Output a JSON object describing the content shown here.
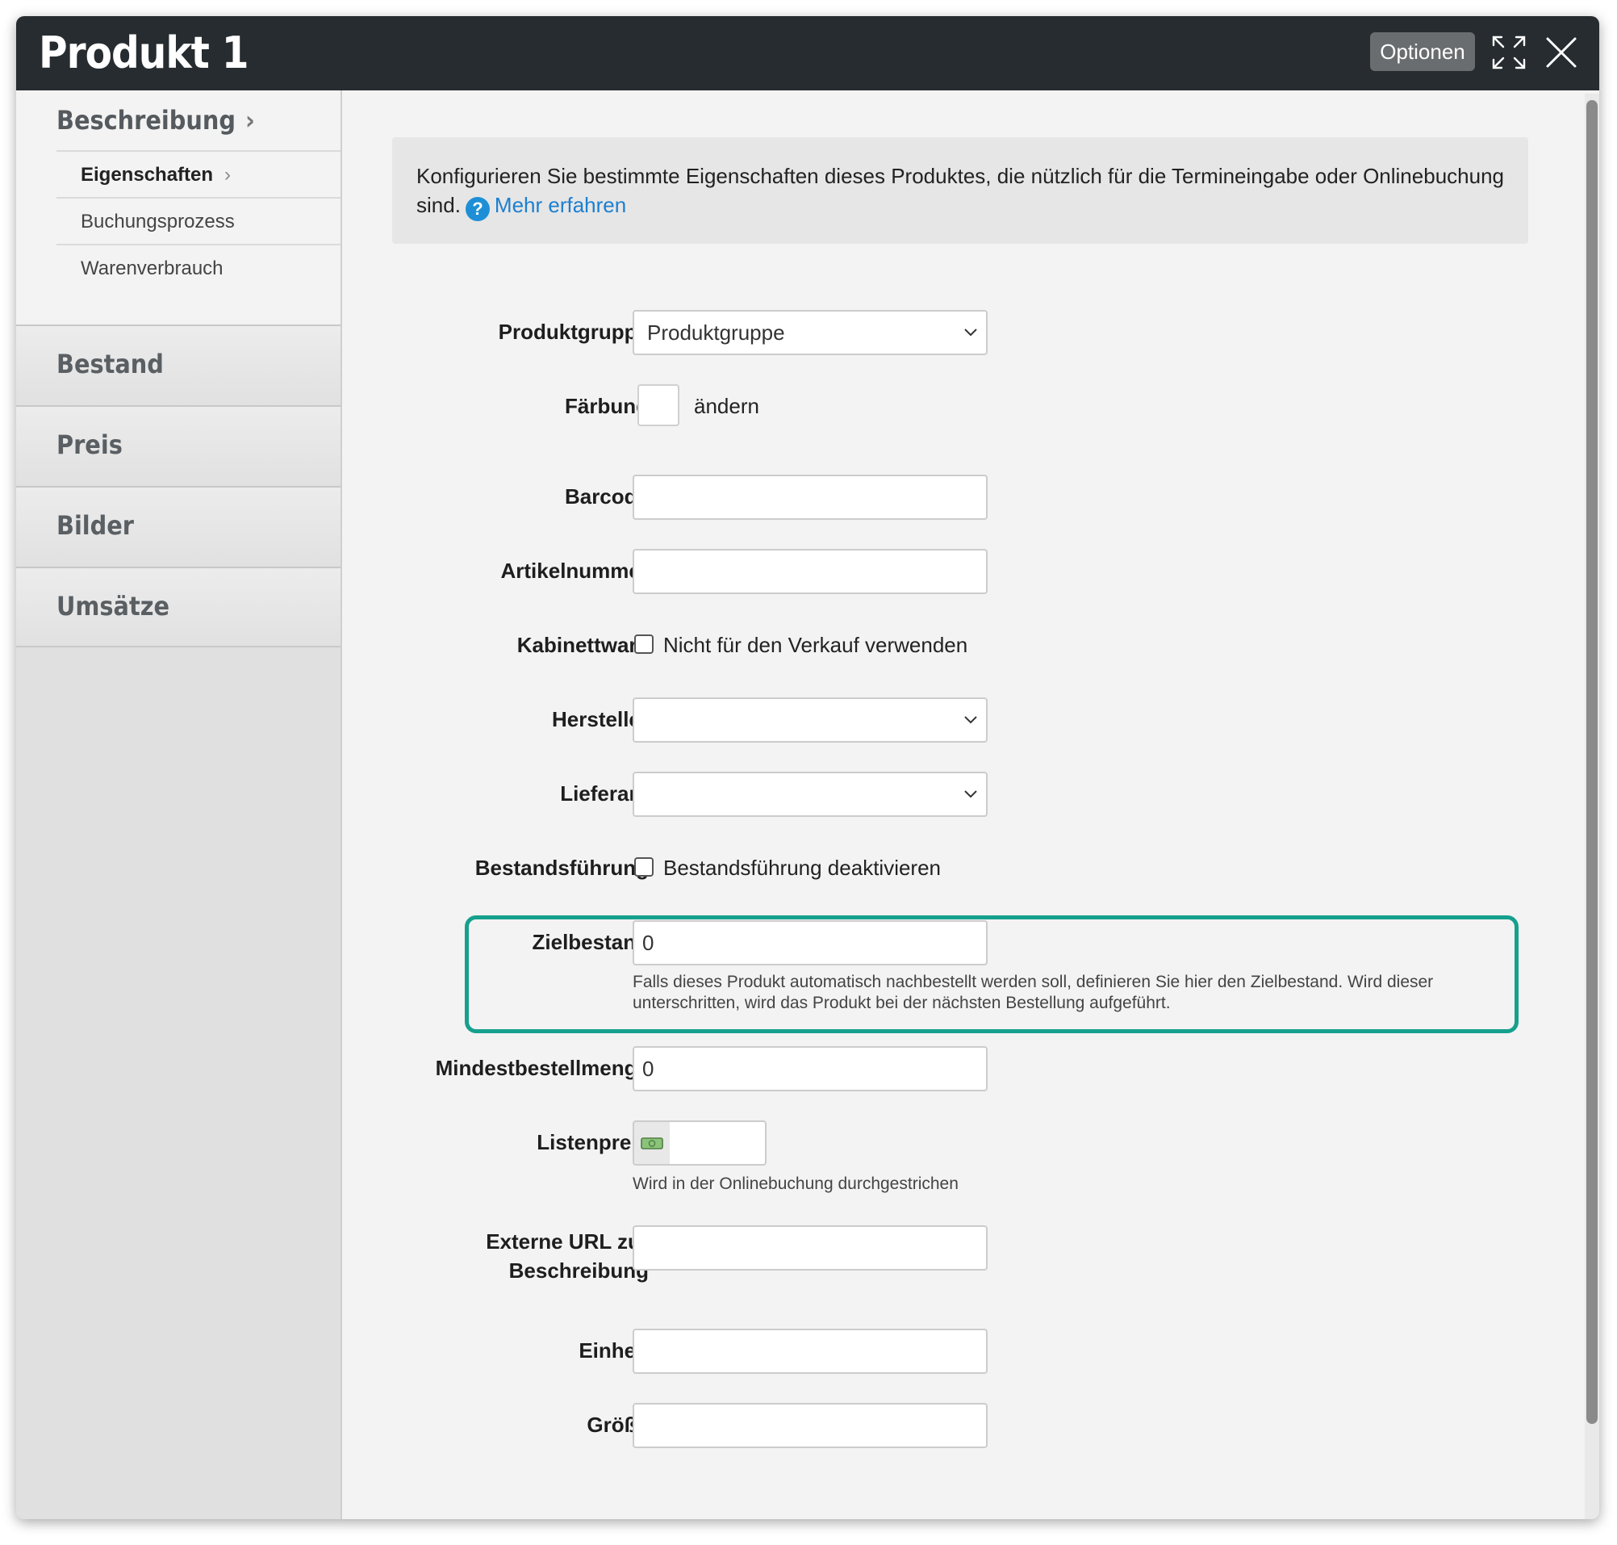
{
  "window": {
    "title": "Produkt 1",
    "options_label": "Optionen"
  },
  "sidebar": {
    "top_item": "Beschreibung",
    "sub_items": [
      {
        "label": "Eigenschaften",
        "active": true
      },
      {
        "label": "Buchungsprozess",
        "active": false
      },
      {
        "label": "Warenverbrauch",
        "active": false
      }
    ],
    "sections": [
      "Bestand",
      "Preis",
      "Bilder",
      "Umsätze"
    ]
  },
  "info": {
    "text": "Konfigurieren Sie bestimmte Eigenschaften dieses Produktes, die nützlich für die Termineingabe oder Onlinebuchung sind.",
    "link": "Mehr erfahren"
  },
  "form": {
    "produktgruppe": {
      "label": "Produktgruppe",
      "value": "Produktgruppe"
    },
    "faerbung": {
      "label": "Färbung",
      "action": "ändern"
    },
    "barcode": {
      "label": "Barcode",
      "value": ""
    },
    "artikelnummer": {
      "label": "Artikelnummer",
      "value": ""
    },
    "kabinettware": {
      "label": "Kabinettware",
      "checkbox_label": "Nicht für den Verkauf verwenden",
      "checked": false
    },
    "hersteller": {
      "label": "Hersteller",
      "value": ""
    },
    "lieferant": {
      "label": "Lieferant",
      "value": ""
    },
    "bestandsfuehrung": {
      "label": "Bestandsführung",
      "checkbox_label": "Bestandsführung deaktivieren",
      "checked": false
    },
    "zielbestand": {
      "label": "Zielbestand",
      "value": "0",
      "hint": "Falls dieses Produkt automatisch nachbestellt werden soll, definieren Sie hier den Zielbestand. Wird dieser unterschritten, wird das Produkt bei der nächsten Bestellung aufgeführt."
    },
    "mindestbestellmenge": {
      "label": "Mindestbestellmenge",
      "value": "0"
    },
    "listenpreis": {
      "label": "Listenpreis",
      "value": "",
      "hint": "Wird in der Onlinebuchung durchgestrichen"
    },
    "externe_url": {
      "label_line1": "Externe URL zur",
      "label_line2": "Beschreibung",
      "value": ""
    },
    "einheit": {
      "label": "Einheit",
      "value": ""
    },
    "groesse": {
      "label": "Größe",
      "value": ""
    }
  },
  "colors": {
    "titlebar": "#262c2f",
    "highlight": "#16a08d",
    "link": "#1c7fd0"
  }
}
